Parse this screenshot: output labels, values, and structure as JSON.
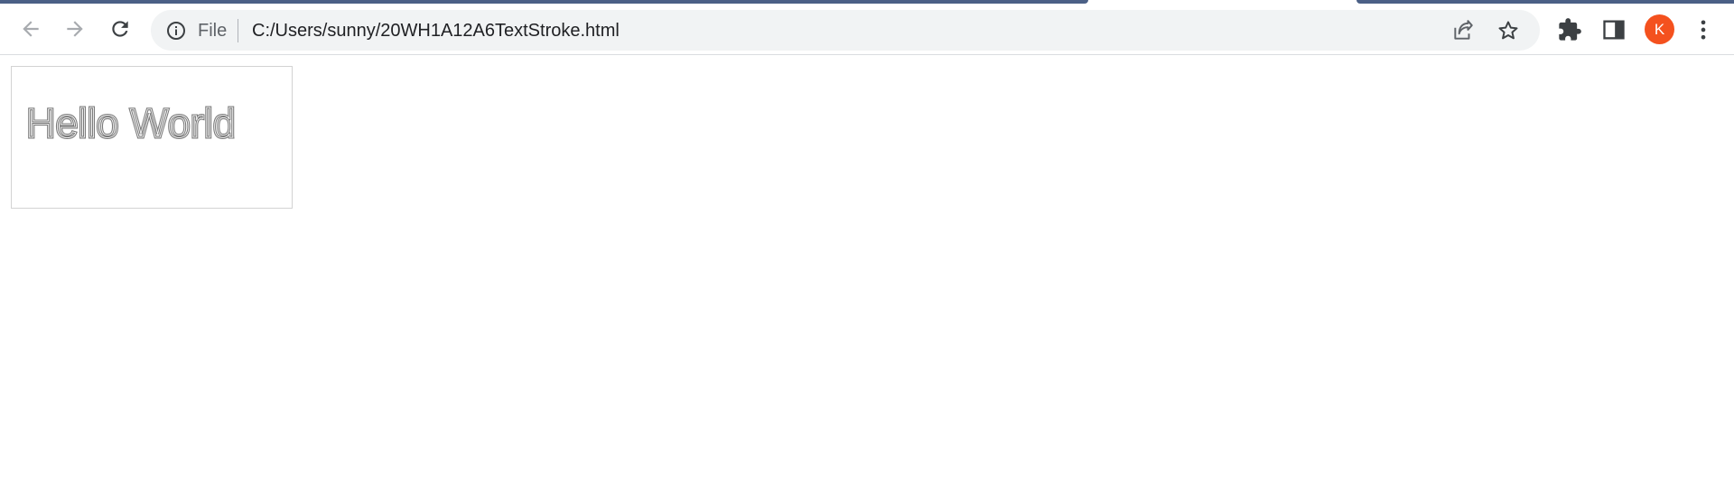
{
  "browser": {
    "address_bar": {
      "scheme_label": "File",
      "url": "C:/Users/sunny/20WH1A12A6TextStroke.html"
    },
    "profile": {
      "initial": "K",
      "color": "#f4511e"
    },
    "accent_color": "#4b6086",
    "icons": {
      "back": "arrow-left-icon",
      "forward": "arrow-right-icon",
      "reload": "reload-icon",
      "info": "info-icon",
      "share": "share-icon",
      "bookmark": "star-icon",
      "extensions": "puzzle-icon",
      "side_panel": "side-panel-icon",
      "menu": "kebab-menu-icon"
    }
  },
  "page": {
    "canvas_text": "Hello World"
  }
}
